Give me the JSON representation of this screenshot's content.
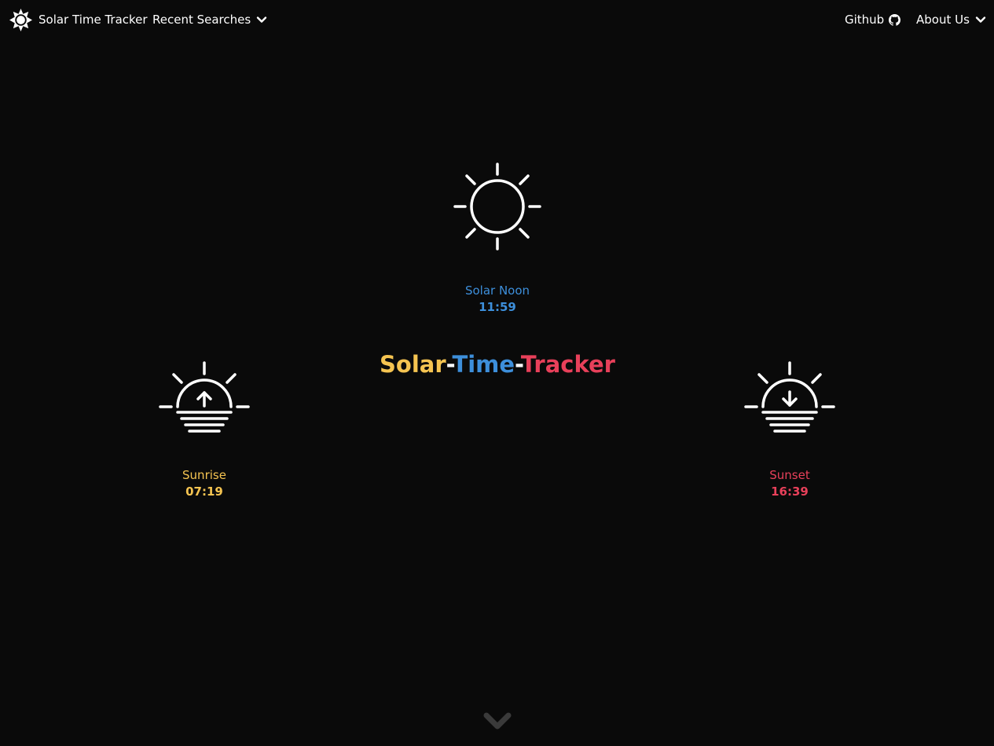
{
  "nav": {
    "brand": "Solar Time Tracker",
    "recent_searches": "Recent Searches",
    "github": "Github",
    "about_us": "About Us"
  },
  "noon": {
    "label": "Solar Noon",
    "time": "11:59"
  },
  "sunrise": {
    "label": "Sunrise",
    "time": "07:19"
  },
  "sunset": {
    "label": "Sunset",
    "time": "16:39"
  },
  "title": {
    "part1": "Solar",
    "sep1": "-",
    "part2": "Time",
    "sep2": "-",
    "part3": "Tracker"
  },
  "colors": {
    "background": "#0a0a0a",
    "sunrise": "#f5c451",
    "noon": "#3d8fdb",
    "sunset": "#e8405a",
    "separator": "#ffffff",
    "scroll_arrow": "#3a3a3a"
  },
  "icons": {
    "brand": "sun-logo-icon",
    "recent": "chevron-down-icon",
    "github": "github-icon",
    "about": "chevron-down-icon",
    "noon": "sun-icon",
    "sunrise": "sunrise-icon",
    "sunset": "sunset-icon",
    "scroll": "chevron-down-icon"
  }
}
